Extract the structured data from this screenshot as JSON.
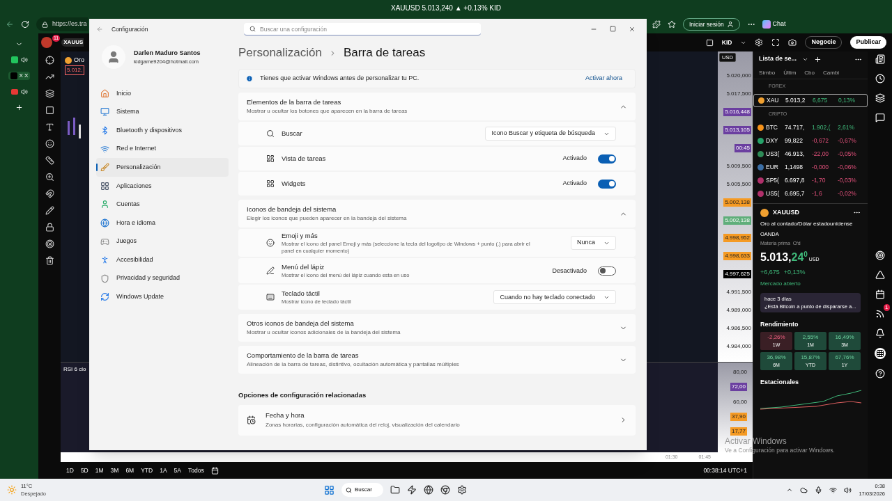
{
  "browser": {
    "ticker": "XAUUSD 5.013,240 ▲ +0.13% KID",
    "url": "https://es.tra",
    "signin": "Iniciar sesión",
    "chat": "Chat",
    "tabs": [
      {
        "label": "X X",
        "selected": true
      }
    ]
  },
  "tv_header": {
    "badge": "11",
    "symbol": "XAUUS",
    "account": "KID",
    "trade": "Negocie",
    "publish": "Publicar",
    "currency": "USD"
  },
  "chart": {
    "legend": "Oro",
    "legend_price": "5.012,",
    "rsi_label": "RSI 6 clo",
    "price_scale": [
      {
        "label": "5.020,000",
        "kind": "tick"
      },
      {
        "label": "5.017,500",
        "kind": "tick"
      },
      {
        "label": "5.016,448",
        "kind": "purple"
      },
      {
        "label": "5.013,105",
        "kind": "purple"
      },
      {
        "label": "00:45",
        "kind": "purple"
      },
      {
        "label": "5.009,500",
        "kind": "tick"
      },
      {
        "label": "5.005,500",
        "kind": "tick"
      },
      {
        "label": "5.002,138",
        "kind": "orange"
      },
      {
        "label": "5.002,138",
        "kind": "green"
      },
      {
        "label": "4.998,952",
        "kind": "orange"
      },
      {
        "label": "4.998,633",
        "kind": "orange"
      },
      {
        "label": "4.997,625",
        "kind": "black"
      },
      {
        "label": "4.991,500",
        "kind": "tick"
      },
      {
        "label": "4.989,000",
        "kind": "tick"
      },
      {
        "label": "4.986,500",
        "kind": "tick"
      },
      {
        "label": "4.984,000",
        "kind": "tick"
      }
    ],
    "rsi_scale": [
      {
        "label": "80,00",
        "kind": "tick"
      },
      {
        "label": "72,00",
        "kind": "purple"
      },
      {
        "label": "60,00",
        "kind": "tick"
      },
      {
        "label": "37,90",
        "kind": "orange"
      },
      {
        "label": "17,77",
        "kind": "orange"
      }
    ],
    "time_axis": [
      "01:30",
      "01:45"
    ],
    "timeframes": [
      "1D",
      "5D",
      "1M",
      "3M",
      "6M",
      "YTD",
      "1A",
      "5A",
      "Todos"
    ],
    "clock": "00:38:14 UTC+1"
  },
  "watchlist": {
    "title": "Lista de se...",
    "columns": [
      "Símbo",
      "Últim",
      "Cbo",
      "Cambi"
    ],
    "groups": [
      {
        "name": "FOREX",
        "rows": [
          {
            "symbol": "XAU",
            "last": "5.013,2",
            "change": "6,675",
            "pct": "0,13%",
            "positive": true,
            "selected": true,
            "color": "#f0a030"
          }
        ]
      },
      {
        "name": "CRIPTO",
        "rows": [
          {
            "symbol": "BTC",
            "last": "74.717,",
            "change": "1.902,(",
            "pct": "2,61%",
            "positive": true,
            "selected": false,
            "color": "#f7931a"
          },
          {
            "symbol": "DXY",
            "last": "99,822",
            "change": "-0,672",
            "pct": "-0,67%",
            "positive": false,
            "selected": false,
            "color": "#26a269"
          },
          {
            "symbol": "US3(",
            "last": "46.913,",
            "change": "-22,00",
            "pct": "-0,05%",
            "positive": false,
            "selected": false,
            "color": "#2e8b57"
          },
          {
            "symbol": "EUR",
            "last": "1,1498",
            "change": "-0,000",
            "pct": "-0,06%",
            "positive": false,
            "selected": false,
            "color": "#3b6ea5"
          },
          {
            "symbol": "SP5(",
            "last": "6.697,8",
            "change": "-1,70",
            "pct": "-0,03%",
            "positive": false,
            "selected": false,
            "color": "#b0306a"
          },
          {
            "symbol": "US5(",
            "last": "6.695,7",
            "change": "-1,6",
            "pct": "-0,02%",
            "positive": false,
            "selected": false,
            "color": "#b0306a"
          }
        ]
      }
    ]
  },
  "details": {
    "symbol": "XAUUSD",
    "name": "Oro al contado/Dólar estadounidense",
    "broker": "OANDA",
    "type": "Materia prima",
    "subtype": "Cfd",
    "price_main": "5.013,",
    "price_accent": "24",
    "price_tail": "0",
    "currency": "USD",
    "change": "+6,675",
    "change_pct": "+0,13%",
    "market": "Mercado abierto",
    "news_time": "hace 3 días",
    "news": "¿Está Bitcoin a punto de dispararse a...",
    "performance_title": "Rendimiento",
    "performance": [
      {
        "value": "-2,26%",
        "period": "1W",
        "positive": false
      },
      {
        "value": "2,55%",
        "period": "1M",
        "positive": true
      },
      {
        "value": "16,49%",
        "period": "3M",
        "positive": true
      },
      {
        "value": "36,98%",
        "period": "6M",
        "positive": true
      },
      {
        "value": "15,87%",
        "period": "YTD",
        "positive": true
      },
      {
        "value": "67,76%",
        "period": "1Y",
        "positive": true
      }
    ],
    "seasonal_title": "Estacionales",
    "alerts_badge": "1"
  },
  "activation": {
    "title": "Activar Windows",
    "subtitle": "Ve a Configuración para activar Windows."
  },
  "settings": {
    "title": "Configuración",
    "search_placeholder": "Buscar una configuración",
    "user": {
      "name": "Darlen Maduro Santos",
      "email": "kidgame9204@hotmail.com"
    },
    "nav": [
      {
        "label": "Inicio",
        "selected": false
      },
      {
        "label": "Sistema",
        "selected": false
      },
      {
        "label": "Bluetooth y dispositivos",
        "selected": false
      },
      {
        "label": "Red e Internet",
        "selected": false
      },
      {
        "label": "Personalización",
        "selected": true
      },
      {
        "label": "Aplicaciones",
        "selected": false
      },
      {
        "label": "Cuentas",
        "selected": false
      },
      {
        "label": "Hora e idioma",
        "selected": false
      },
      {
        "label": "Juegos",
        "selected": false
      },
      {
        "label": "Accesibilidad",
        "selected": false
      },
      {
        "label": "Privacidad y seguridad",
        "selected": false
      },
      {
        "label": "Windows Update",
        "selected": false
      }
    ],
    "breadcrumb": [
      "Personalización",
      "Barra de tareas"
    ],
    "banner": {
      "text": "Tienes que activar Windows antes de personalizar tu PC.",
      "action": "Activar ahora"
    },
    "sections": [
      {
        "title": "Elementos de la barra de tareas",
        "subtitle": "Mostrar u ocultar los botones que aparecen en la barra de tareas",
        "expanded": true,
        "items": [
          {
            "kind": "dropdown",
            "label": "Buscar",
            "value": "Icono Buscar y etiqueta de búsqueda"
          },
          {
            "kind": "toggle",
            "label": "Vista de tareas",
            "state_label": "Activado",
            "on": true
          },
          {
            "kind": "toggle",
            "label": "Widgets",
            "state_label": "Activado",
            "on": true
          }
        ]
      },
      {
        "title": "Iconos de bandeja del sistema",
        "subtitle": "Elegir los iconos que pueden aparecer en la bandeja del sistema",
        "expanded": true,
        "items": [
          {
            "kind": "dropdown",
            "label": "Emoji y más",
            "description": "Mostrar el icono del panel Emoji y más (seleccione la tecla del logotipo de Windows + punto (.) para abrir el panel en cualquier momento)",
            "value": "Nunca"
          },
          {
            "kind": "toggle",
            "label": "Menú del lápiz",
            "description": "Mostrar el icono del menú del lápiz cuando esta en uso",
            "state_label": "Desactivado",
            "on": false
          },
          {
            "kind": "dropdown",
            "label": "Teclado táctil",
            "description": "Mostrar icono de teclado táctil",
            "value": "Cuando no hay teclado conectado"
          }
        ]
      },
      {
        "title": "Otros iconos de bandeja del sistema",
        "subtitle": "Mostrar u ocultar iconos adicionales de la bandeja del sistema",
        "expanded": false
      },
      {
        "title": "Comportamiento de la barra de tareas",
        "subtitle": "Alineación de la barra de tareas, distintivo, ocultación automática y pantallas múltiples",
        "expanded": false
      }
    ],
    "related_title": "Opciones de configuración relacionadas",
    "related": [
      {
        "title": "Fecha y hora",
        "subtitle": "Zonas horarias, configuración automática del reloj, visualización del calendario"
      }
    ]
  },
  "taskbar": {
    "temperature": "11°C",
    "weather": "Despejado",
    "search": "Buscar",
    "time": "0:38",
    "date": "17/03/2026"
  }
}
